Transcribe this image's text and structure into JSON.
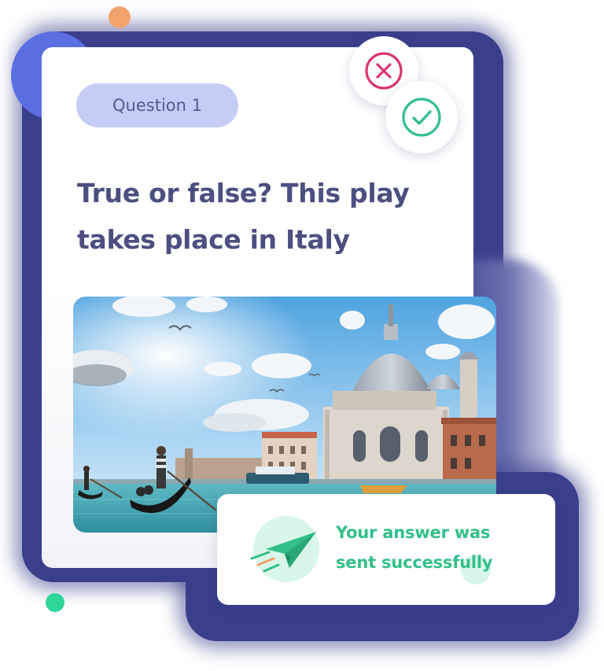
{
  "quiz": {
    "badge_label": "Question 1",
    "question_line1": "True or false? This play",
    "question_line2": "takes place in Italy"
  },
  "answers": {
    "false_icon": "x-icon",
    "true_icon": "check-icon",
    "false_color": "#d8386a",
    "true_color": "#33bf8a"
  },
  "photo": {
    "subject": "venice-canal-photo"
  },
  "notification": {
    "line1": "Your answer was",
    "line2": "sent successfully",
    "icon": "paper-plane-icon"
  },
  "colors": {
    "background_frame": "#3a3f8c",
    "badge_bg": "#c5cdf7",
    "question_text": "#4c4f80",
    "success_text": "#33bf8a"
  }
}
